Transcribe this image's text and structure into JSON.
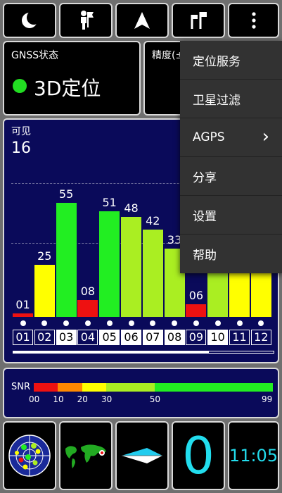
{
  "toolbar": {
    "buttons": [
      {
        "name": "night-mode-icon"
      },
      {
        "name": "person-icon"
      },
      {
        "name": "navigation-arrow-icon"
      },
      {
        "name": "flags-icon"
      },
      {
        "name": "overflow-menu-icon"
      }
    ]
  },
  "gnss": {
    "label": "GNSS状态",
    "status": "3D定位",
    "status_color": "#22dd22"
  },
  "accuracy": {
    "label": "精度(±"
  },
  "menu": {
    "items": [
      {
        "label": "定位服务"
      },
      {
        "label": "卫星过滤"
      },
      {
        "label": "AGPS",
        "has_submenu": true
      },
      {
        "label": "分享"
      },
      {
        "label": "设置"
      },
      {
        "label": "帮助"
      }
    ],
    "submenu_chevron": "›"
  },
  "satellites": {
    "visible_label": "可见",
    "visible_count": "16",
    "colors": {
      "red": "#ee1111",
      "orange": "#ff8800",
      "yellow": "#ffff00",
      "lime": "#aaee22",
      "green": "#22ee22"
    },
    "bars": [
      {
        "prn": "01",
        "snr": 1,
        "label": "01",
        "color": "#ee1111",
        "used": false
      },
      {
        "prn": "02",
        "snr": 25,
        "label": "25",
        "color": "#ffff00",
        "used": false
      },
      {
        "prn": "03",
        "snr": 55,
        "label": "55",
        "color": "#22ee22",
        "used": true
      },
      {
        "prn": "04",
        "snr": 8,
        "label": "08",
        "color": "#ee1111",
        "used": false
      },
      {
        "prn": "05",
        "snr": 51,
        "label": "51",
        "color": "#22ee22",
        "used": true
      },
      {
        "prn": "06",
        "snr": 48,
        "label": "48",
        "color": "#aaee22",
        "used": true
      },
      {
        "prn": "07",
        "snr": 42,
        "label": "42",
        "color": "#aaee22",
        "used": true
      },
      {
        "prn": "08",
        "snr": 33,
        "label": "33",
        "color": "#aaee22",
        "used": true
      },
      {
        "prn": "09",
        "snr": 6,
        "label": "06",
        "color": "#ee1111",
        "used": false
      },
      {
        "prn": "10",
        "snr": 40,
        "label": "",
        "color": "#aaee22",
        "used": true
      },
      {
        "prn": "11",
        "snr": 40,
        "label": "",
        "color": "#ffff00",
        "used": false
      },
      {
        "prn": "12",
        "snr": 40,
        "label": "",
        "color": "#ffff00",
        "used": false
      }
    ]
  },
  "snr_legend": {
    "label": "SNR",
    "ticks": [
      "00",
      "10",
      "20",
      "30",
      "50",
      "99"
    ],
    "segments": [
      {
        "from": 0,
        "to": 10,
        "color": "#ee1111"
      },
      {
        "from": 10,
        "to": 20,
        "color": "#ff8800"
      },
      {
        "from": 20,
        "to": 30,
        "color": "#ffff00"
      },
      {
        "from": 30,
        "to": 50,
        "color": "#aaee22"
      },
      {
        "from": 50,
        "to": 99,
        "color": "#22ee22"
      }
    ]
  },
  "bottom": {
    "satellite_count": "0",
    "time": "11:05"
  }
}
